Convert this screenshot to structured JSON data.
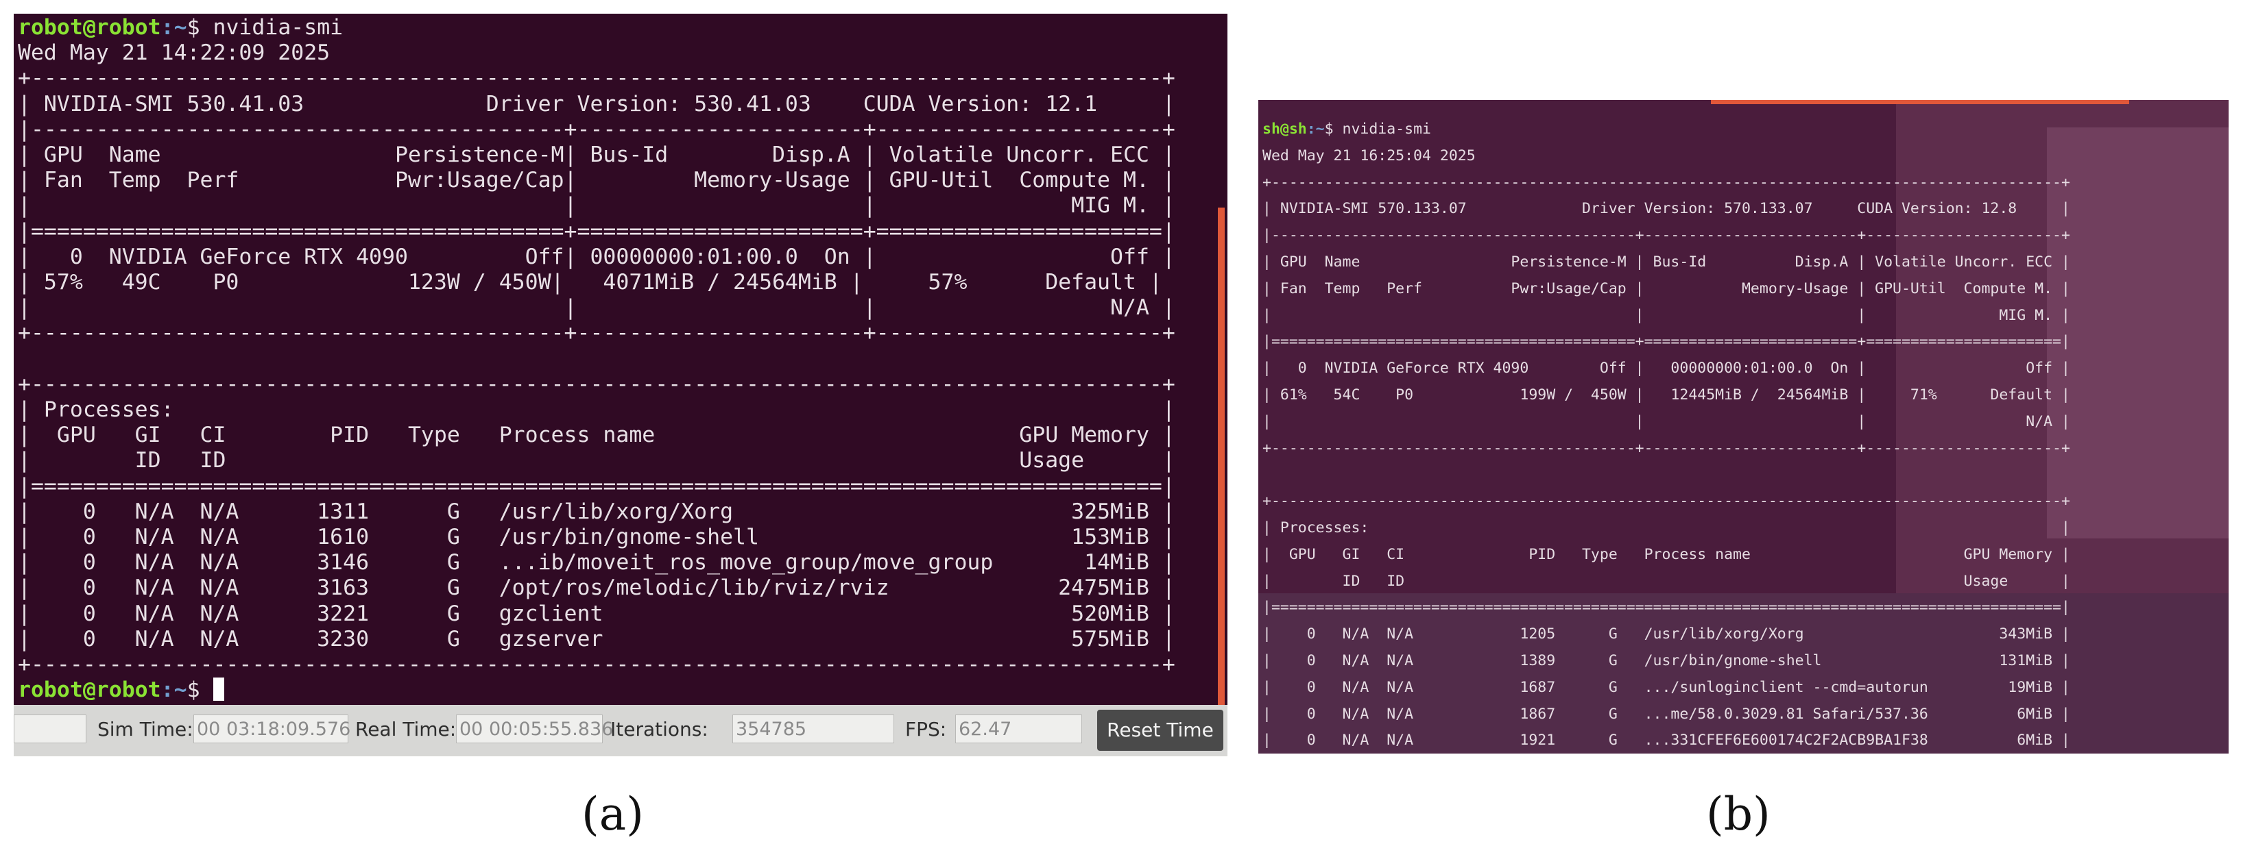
{
  "panel_a": {
    "lines": [
      {
        "user": "robot@robot",
        "path": ":~",
        "cmd": "$ nvidia-smi"
      },
      {
        "text": "Wed May 21 14:22:09 2025"
      },
      {
        "text": "+---------------------------------------------------------------------------------------+"
      },
      {
        "text": "| NVIDIA-SMI 530.41.03              Driver Version: 530.41.03    CUDA Version: 12.1     |"
      },
      {
        "text": "|-----------------------------------------+----------------------+----------------------+"
      },
      {
        "text": "| GPU  Name                  Persistence-M| Bus-Id        Disp.A | Volatile Uncorr. ECC |"
      },
      {
        "text": "| Fan  Temp  Perf            Pwr:Usage/Cap|         Memory-Usage | GPU-Util  Compute M. |"
      },
      {
        "text": "|                                         |                      |               MIG M. |"
      },
      {
        "text": "|=========================================+======================+======================|"
      },
      {
        "text": "|   0  NVIDIA GeForce RTX 4090         Off| 00000000:01:00.0  On |                  Off |"
      },
      {
        "text": "| 57%   49C    P0             123W / 450W|   4071MiB / 24564MiB |     57%      Default |"
      },
      {
        "text": "|                                         |                      |                  N/A |"
      },
      {
        "text": "+-----------------------------------------+----------------------+----------------------+"
      },
      {
        "text": ""
      },
      {
        "text": "+---------------------------------------------------------------------------------------+"
      },
      {
        "text": "| Processes:                                                                            |"
      },
      {
        "text": "|  GPU   GI   CI        PID   Type   Process name                            GPU Memory |"
      },
      {
        "text": "|        ID   ID                                                             Usage      |"
      },
      {
        "text": "|=======================================================================================|"
      },
      {
        "text": "|    0   N/A  N/A      1311      G   /usr/lib/xorg/Xorg                          325MiB |"
      },
      {
        "text": "|    0   N/A  N/A      1610      G   /usr/bin/gnome-shell                        153MiB |"
      },
      {
        "text": "|    0   N/A  N/A      3146      G   ...ib/moveit_ros_move_group/move_group       14MiB |"
      },
      {
        "text": "|    0   N/A  N/A      3163      G   /opt/ros/melodic/lib/rviz/rviz             2475MiB |"
      },
      {
        "text": "|    0   N/A  N/A      3221      G   gzclient                                    520MiB |"
      },
      {
        "text": "|    0   N/A  N/A      3230      G   gzserver                                    575MiB |"
      },
      {
        "text": "+---------------------------------------------------------------------------------------+"
      },
      {
        "user": "robot@robot",
        "path": ":~",
        "cmd": "$ ",
        "cursor": true
      }
    ],
    "status": {
      "sim_time_label": "Sim Time:",
      "sim_time_value": "00 03:18:09.576",
      "real_time_label": "Real Time:",
      "real_time_value": "00 00:05:55.836",
      "iterations_label": "Iterations:",
      "iterations_value": "354785",
      "fps_label": "FPS:",
      "fps_value": "62.47",
      "reset_button": "Reset Time"
    }
  },
  "panel_b": {
    "lines": [
      {
        "user": "sh@sh",
        "path": ":~",
        "cmd": "$ nvidia-smi"
      },
      {
        "text": "Wed May 21 16:25:04 2025"
      },
      {
        "text": "+-----------------------------------------------------------------------------------------+"
      },
      {
        "text": "| NVIDIA-SMI 570.133.07             Driver Version: 570.133.07     CUDA Version: 12.8     |"
      },
      {
        "text": "|-----------------------------------------+------------------------+----------------------+"
      },
      {
        "text": "| GPU  Name                 Persistence-M | Bus-Id          Disp.A | Volatile Uncorr. ECC |"
      },
      {
        "text": "| Fan  Temp   Perf          Pwr:Usage/Cap |           Memory-Usage | GPU-Util  Compute M. |"
      },
      {
        "text": "|                                         |                        |               MIG M. |"
      },
      {
        "text": "|=========================================+========================+======================|"
      },
      {
        "text": "|   0  NVIDIA GeForce RTX 4090        Off |   00000000:01:00.0  On |                  Off |"
      },
      {
        "text": "| 61%   54C    P0            199W /  450W |   12445MiB /  24564MiB |     71%      Default |"
      },
      {
        "text": "|                                         |                        |                  N/A |"
      },
      {
        "text": "+-----------------------------------------+------------------------+----------------------+"
      },
      {
        "text": ""
      },
      {
        "text": "+-----------------------------------------------------------------------------------------+"
      },
      {
        "text": "| Processes:                                                                              |"
      },
      {
        "text": "|  GPU   GI   CI              PID   Type   Process name                        GPU Memory |"
      },
      {
        "text": "|        ID   ID                                                               Usage      |"
      },
      {
        "text": "|=========================================================================================|"
      },
      {
        "text": "|    0   N/A  N/A            1205      G   /usr/lib/xorg/Xorg                      343MiB |"
      },
      {
        "text": "|    0   N/A  N/A            1389      G   /usr/bin/gnome-shell                    131MiB |"
      },
      {
        "text": "|    0   N/A  N/A            1687      G   .../sunloginclient --cmd=autorun         19MiB |"
      },
      {
        "text": "|    0   N/A  N/A            1867      G   ...me/58.0.3029.81 Safari/537.36          6MiB |"
      },
      {
        "text": "|    0   N/A  N/A            1921      G   ...331CFEF6E600174C2F2ACB9BA1F38          6MiB |"
      }
    ]
  },
  "captions": {
    "a": "(a)",
    "b": "(b)"
  }
}
